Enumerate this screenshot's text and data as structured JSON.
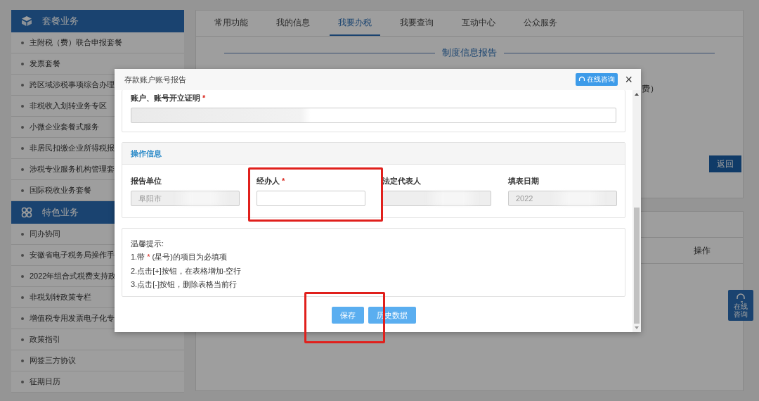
{
  "sidebar": {
    "sections": [
      {
        "title": "套餐业务",
        "items": [
          "主附税（费）联合申报套餐",
          "发票套餐",
          "跨区域涉税事项综合办理",
          "非税收入划转业务专区",
          "小微企业套餐式服务",
          "非居民扣缴企业所得税报",
          "涉税专业服务机构管理套",
          "国际税收业务套餐"
        ]
      },
      {
        "title": "特色业务",
        "items": [
          "同办协同",
          "安徽省电子税务局操作手",
          "2022年组合式税费支持政",
          "非税划转政策专栏",
          "增值税专用发票电子化专",
          "政策指引",
          "网签三方协议",
          "征期日历"
        ]
      }
    ]
  },
  "main": {
    "tabs": [
      {
        "label": "常用功能",
        "selected": false
      },
      {
        "label": "我的信息",
        "selected": false
      },
      {
        "label": "我要办税",
        "selected": true
      },
      {
        "label": "我要查询",
        "selected": false
      },
      {
        "label": "互动中心",
        "selected": false
      },
      {
        "label": "公众服务",
        "selected": false
      }
    ],
    "heading": "制度信息报告",
    "fragment": "费）",
    "back_button": "返回",
    "table_column": "操作",
    "help_button": "在线咨询"
  },
  "modal": {
    "title": "存款账户账号报告",
    "consult_button": "在线咨询",
    "close": "×",
    "proof": {
      "label": "账户、账号开立证明",
      "mark": "*",
      "redacted": true
    },
    "section": {
      "title": "操作信息",
      "fields": [
        {
          "label": "报告单位",
          "value": "阜阳市",
          "readonly": true,
          "redacted": true
        },
        {
          "label": "经办人",
          "mark": "*",
          "readonly": false,
          "redacted": false
        },
        {
          "label": "法定代表人",
          "readonly": true,
          "redacted": true
        },
        {
          "label": "填表日期",
          "value": "2022",
          "readonly": true,
          "redacted": true
        }
      ]
    },
    "tips": {
      "title": "温馨提示:",
      "lines": [
        {
          "before": "1.带",
          "mark": "*",
          "after": "(星号)的项目为必填项"
        },
        {
          "before": "2.点击[+]按钮，在表格增加-空行"
        },
        {
          "before": "3.点击[-]按钮，删除表格当前行"
        }
      ]
    },
    "buttons": [
      "保存",
      "历史数据"
    ]
  }
}
